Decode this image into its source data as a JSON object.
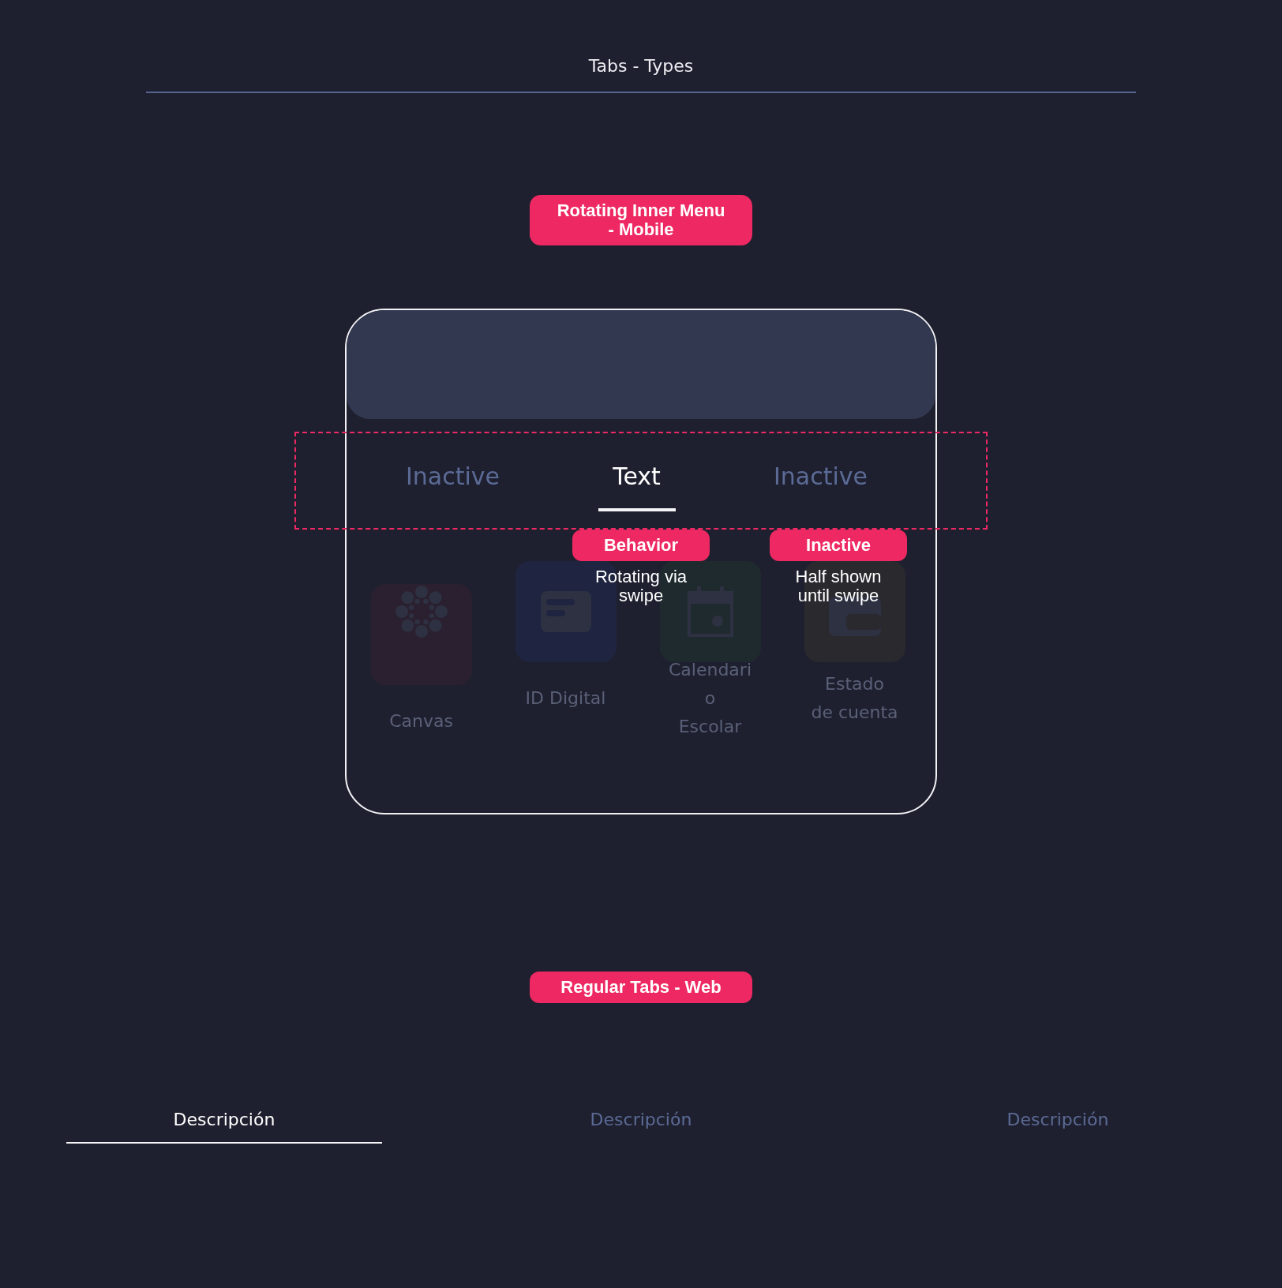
{
  "header": {
    "title": "Tabs - Types"
  },
  "mobile_section": {
    "badge": "Rotating Inner Menu\n- Mobile",
    "tabs": [
      {
        "label": "Inactive",
        "selected": false
      },
      {
        "label": "Text",
        "selected": true
      },
      {
        "label": "Inactive",
        "selected": false
      }
    ],
    "annotations": [
      {
        "badge": "Behavior",
        "note": "Rotating via\nswipe"
      },
      {
        "badge": "Inactive",
        "note": "Half shown\nuntil swipe"
      }
    ],
    "apps": [
      {
        "label": "Canvas",
        "color": "#2a2030"
      },
      {
        "label": "ID Digital",
        "color": "#1f2540"
      },
      {
        "label": "Calendari\no\nEscolar",
        "color": "#1f2a2e"
      },
      {
        "label": "Estado\nde cuenta",
        "color": "#29292e"
      }
    ]
  },
  "web_section": {
    "badge": "Regular Tabs - Web",
    "tabs": [
      {
        "label": "Descripción",
        "selected": true
      },
      {
        "label": "Descripción",
        "selected": false
      },
      {
        "label": "Descripción",
        "selected": false
      }
    ]
  }
}
